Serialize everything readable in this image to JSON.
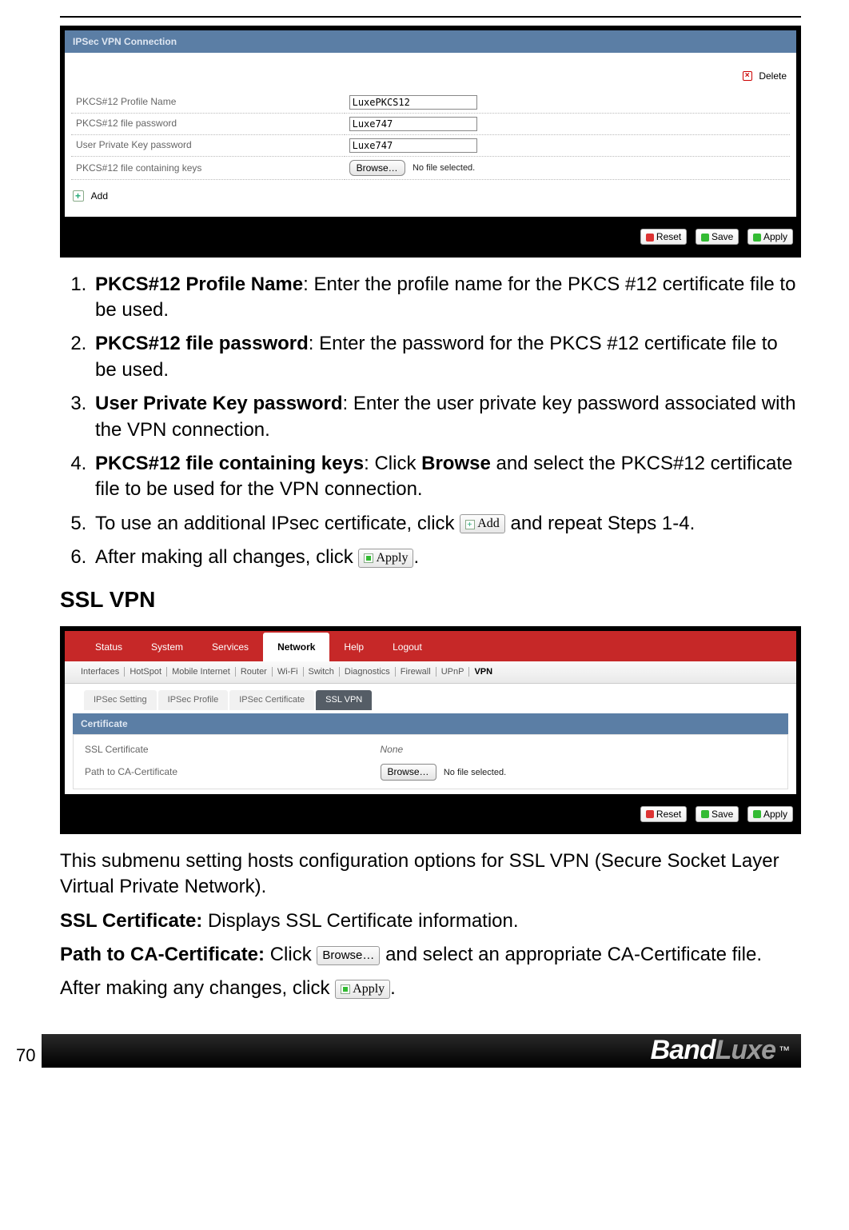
{
  "page_number": "70",
  "brand": {
    "part1": "Band",
    "part2": "Luxe",
    "tm": "™"
  },
  "ipsec": {
    "header": "IPSec VPN Connection",
    "delete_label": "Delete",
    "add_label": "Add",
    "reset_label": "Reset",
    "save_label": "Save",
    "apply_label": "Apply",
    "browse_label": "Browse…",
    "no_file_label": "No file selected.",
    "rows": [
      {
        "label": "PKCS#12 Profile Name",
        "value": "LuxePKCS12",
        "type": "text"
      },
      {
        "label": "PKCS#12 file password",
        "value": "Luxe747",
        "type": "text"
      },
      {
        "label": "User Private Key password",
        "value": "Luxe747",
        "type": "text"
      },
      {
        "label": "PKCS#12 file containing keys",
        "value": "",
        "type": "file"
      }
    ]
  },
  "instructions": {
    "i1_bold": "PKCS#12 Profile Name",
    "i1_rest": ": Enter the profile name for the PKCS #12 certificate file to be used.",
    "i2_bold": "PKCS#12 file password",
    "i2_rest": ": Enter the password for the PKCS #12 certificate file to be used.",
    "i3_bold": "User Private Key password",
    "i3_rest": ": Enter the user private key password associated with the VPN connection.",
    "i4_bold": "PKCS#12 file containing keys",
    "i4_mid": ": Click ",
    "i4_bold2": "Browse",
    "i4_rest": " and select the PKCS#12 certificate file to be used for the VPN connection.",
    "i5_a": "To use an additional IPsec certificate, click ",
    "i5_btn": "Add",
    "i5_b": " and repeat Steps 1-4.",
    "i6_a": "After making all changes, click ",
    "i6_btn": "Apply",
    "i6_b": "."
  },
  "ssl_section_title": "SSL VPN",
  "ssl": {
    "main_tabs": [
      "Status",
      "System",
      "Services",
      "Network",
      "Help",
      "Logout"
    ],
    "main_active": "Network",
    "subnav": [
      "Interfaces",
      "HotSpot",
      "Mobile Internet",
      "Router",
      "Wi-Fi",
      "Switch",
      "Diagnostics",
      "Firewall",
      "UPnP",
      "VPN"
    ],
    "subnav_active": "VPN",
    "subtabs": [
      "IPSec Setting",
      "IPSec Profile",
      "IPSec Certificate",
      "SSL VPN"
    ],
    "subtab_active": "SSL VPN",
    "cert_header": "Certificate",
    "ssl_cert_label": "SSL Certificate",
    "ssl_cert_value": "None",
    "path_label": "Path to CA-Certificate",
    "browse_label": "Browse…",
    "no_file_label": "No file selected.",
    "reset_label": "Reset",
    "save_label": "Save",
    "apply_label": "Apply"
  },
  "ssl_paras": {
    "p1": "This submenu setting hosts configuration options for SSL VPN (Secure Socket Layer Virtual Private Network).",
    "p2_bold": "SSL Certificate:",
    "p2_rest": " Displays SSL Certificate information.",
    "p3_bold": "Path to CA-Certificate:",
    "p3_a": " Click ",
    "p3_btn": "Browse…",
    "p3_b": " and select an appropriate CA-Certificate file.",
    "p4_a": "After making any changes, click ",
    "p4_btn": "Apply",
    "p4_b": "."
  }
}
